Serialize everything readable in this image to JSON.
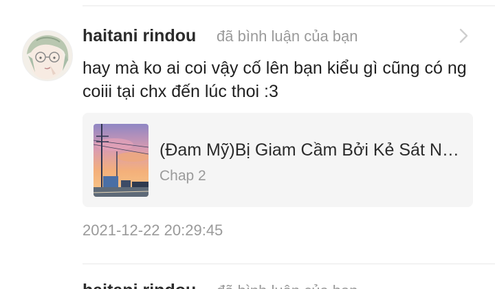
{
  "notification": {
    "username": "haitani rindou",
    "action": "đã bình luận của bạn",
    "comment_text": "hay mà ko ai coi vậy cố lên bạn kiểu gì cũng có ng coiii tại chx đến lúc thoi :3",
    "card": {
      "title": "(Đam Mỹ)Bị Giam Cầm Bởi Kẻ Sát Nhân",
      "chapter": "Chap 2"
    },
    "timestamp": "2021-12-22 20:29:45"
  },
  "next_notification": {
    "username": "haitani rindou",
    "action": "đã bình luận của bạn"
  },
  "icons": {
    "avatar": "user-avatar",
    "chevron": "chevron-right-icon",
    "cover": "story-cover-image"
  },
  "colors": {
    "primary_text": "#222222",
    "secondary_text": "#9a9a9a",
    "card_background": "#f5f5f5",
    "divider": "#e8e8e8"
  }
}
